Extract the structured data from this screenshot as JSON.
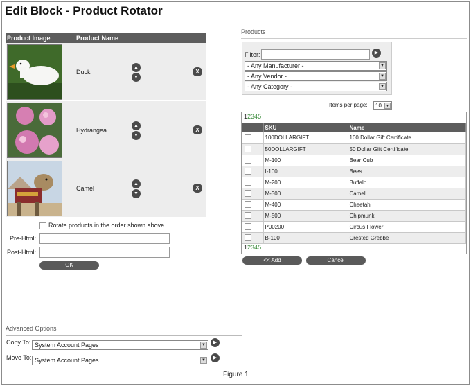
{
  "page_title": "Edit Block - Product Rotator",
  "product_table": {
    "col_image": "Product Image",
    "col_name": "Product Name",
    "rows": [
      {
        "name": "Duck",
        "up_icon": "up-arrow-icon",
        "down_icon": "down-arrow-icon",
        "remove_label": "X"
      },
      {
        "name": "Hydrangea",
        "up_icon": "up-arrow-icon",
        "down_icon": "down-arrow-icon",
        "remove_label": "X"
      },
      {
        "name": "Camel",
        "up_icon": "up-arrow-icon",
        "down_icon": "down-arrow-icon",
        "remove_label": "X"
      }
    ]
  },
  "rotate_label": "Rotate products in the order shown above",
  "pre_html_label": "Pre-Html:",
  "post_html_label": "Post-Html:",
  "pre_html_value": "",
  "post_html_value": "",
  "ok_label": "OK",
  "advanced": {
    "title": "Advanced Options",
    "copy_to_label": "Copy To:",
    "copy_to_value": "System Account Pages",
    "move_to_label": "Move To:",
    "move_to_value": "System Account Pages"
  },
  "products_panel": {
    "title": "Products",
    "filter_label": "Filter:",
    "filter_value": "",
    "manufacturer": "- Any Manufacturer -",
    "vendor": "- Any Vendor -",
    "category": "- Any Category -",
    "items_per_page_label": "Items per page:",
    "items_per_page_value": "10",
    "pager": [
      "1",
      "2",
      "3",
      "4",
      "5"
    ],
    "columns": [
      "SKU",
      "Name"
    ],
    "rows": [
      {
        "sku": "100DOLLARGIFT",
        "name": "100 Dollar Gift Certificate"
      },
      {
        "sku": "50DOLLARGIFT",
        "name": "50 Dollar Gift Certificate"
      },
      {
        "sku": "M-100",
        "name": "Bear Cub"
      },
      {
        "sku": "I-100",
        "name": "Bees"
      },
      {
        "sku": "M-200",
        "name": "Buffalo"
      },
      {
        "sku": "M-300",
        "name": "Camel"
      },
      {
        "sku": "M-400",
        "name": "Cheetah"
      },
      {
        "sku": "M-500",
        "name": "Chipmunk"
      },
      {
        "sku": "P00200",
        "name": "Circus Flower"
      },
      {
        "sku": "B-100",
        "name": "Crested Grebbe"
      }
    ],
    "add_label": "<< Add",
    "cancel_label": "Cancel"
  },
  "caption": "Figure 1",
  "colors": {
    "header_bg": "#5d5d5d",
    "row_bg": "#ededed",
    "pager_link": "#3a8a3a"
  }
}
